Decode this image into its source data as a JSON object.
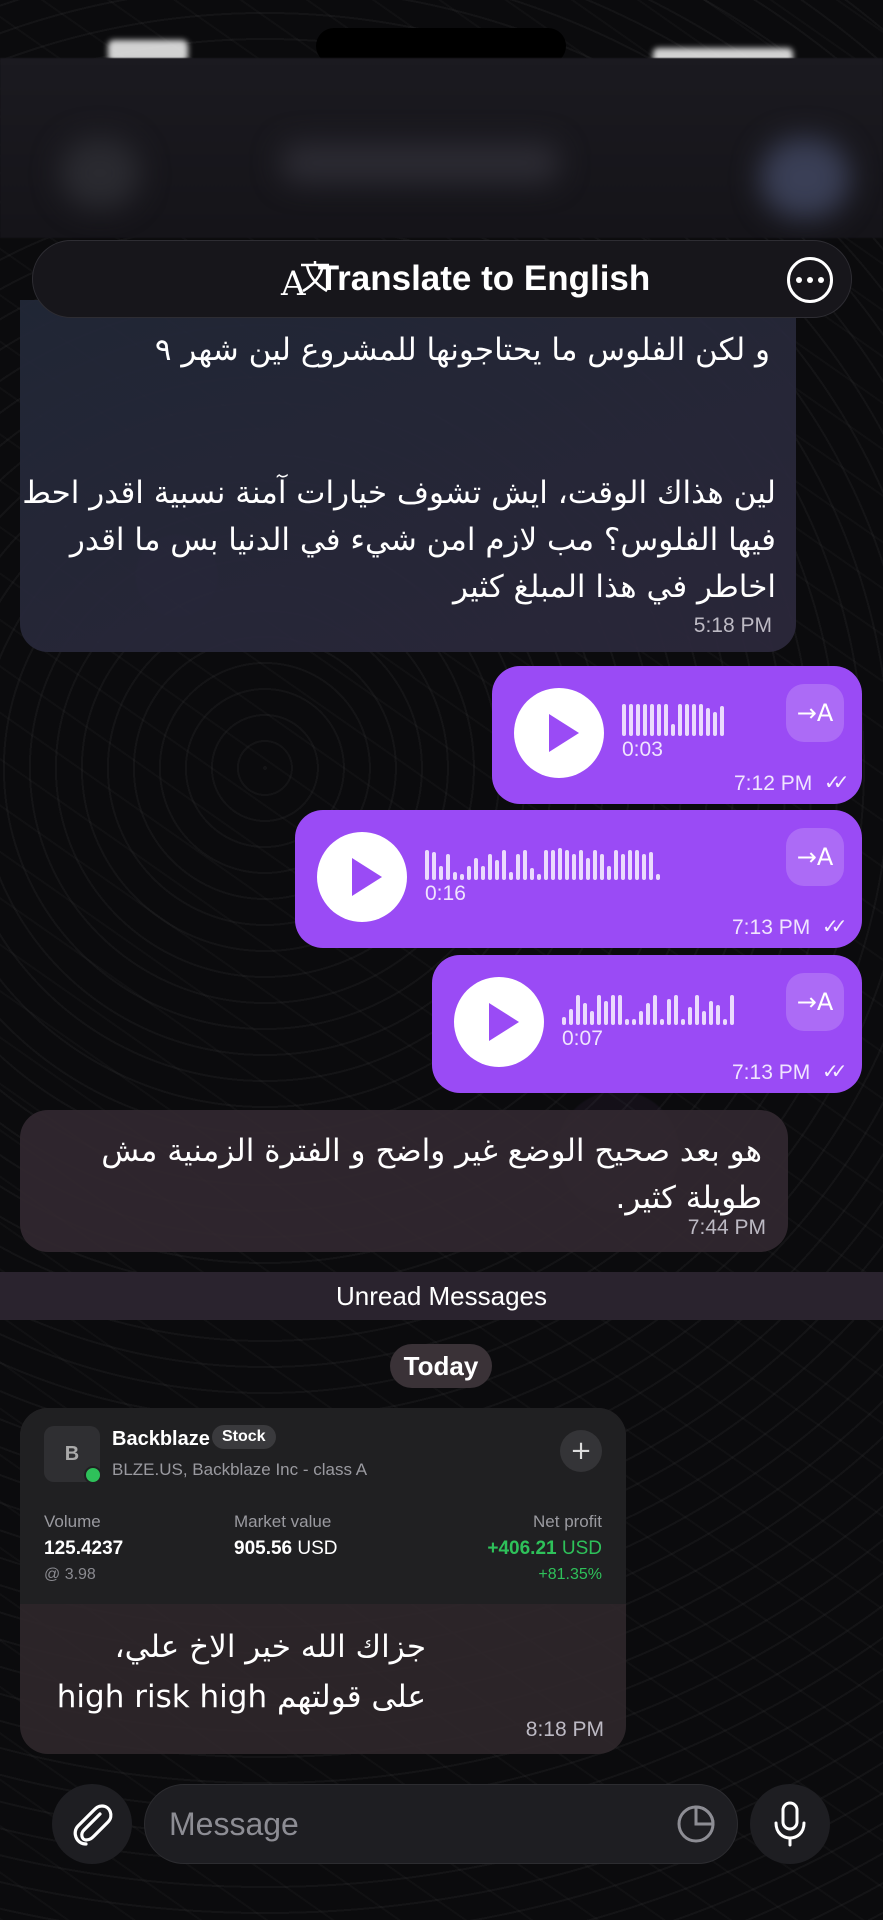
{
  "translate_bar": {
    "icon": "translate-icon",
    "label": "Translate to English",
    "more_icon": "more-icon"
  },
  "messages": {
    "first": {
      "line1": "و لكن الفلوس ما يحتاجونها للمشروع لين شهر ٩",
      "para": "لين هذاك الوقت، ايش تشوف خيارات آمنة نسبية اقدر احط فيها الفلوس؟ مب لازم امن شيء في الدنيا بس ما اقدر اخاطر في هذا المبلغ كثير",
      "time": "5:18 PM"
    },
    "voices": [
      {
        "duration": "0:03",
        "time": "7:12 PM",
        "translate": "→A"
      },
      {
        "duration": "0:16",
        "time": "7:13 PM",
        "translate": "→A"
      },
      {
        "duration": "0:07",
        "time": "7:13 PM",
        "translate": "→A"
      }
    ],
    "incoming2": {
      "text": "هو بعد صحيح الوضع غير واضح و الفترة الزمنية مش طويلة كثير.",
      "time": "7:44 PM"
    }
  },
  "divider": {
    "unread": "Unread Messages",
    "today": "Today"
  },
  "stock": {
    "avatar": "B",
    "name": "Backblaze",
    "badge": "Stock",
    "sub": "BLZE.US, Backblaze Inc - class A",
    "volume_label": "Volume",
    "volume_value": "125.4237",
    "volume_sub": "@ 3.98",
    "market_label": "Market value",
    "market_value": "905.56",
    "market_unit": "USD",
    "profit_label": "Net profit",
    "profit_value": "+406.21",
    "profit_unit": "USD",
    "profit_pct": "+81.35%",
    "text_line1": "جزاك الله خير الاخ علي،",
    "text_line2": "على قولتهم high risk high",
    "time": "8:18 PM"
  },
  "composer": {
    "placeholder": "Message",
    "attach_icon": "paperclip-icon",
    "sticker_icon": "sticker-icon",
    "mic_icon": "microphone-icon"
  }
}
